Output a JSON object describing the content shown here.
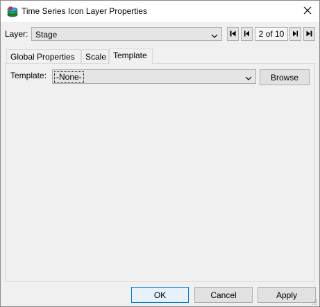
{
  "window": {
    "title": "Time Series Icon Layer Properties"
  },
  "layer": {
    "label": "Layer:",
    "selected": "Stage",
    "page_indicator": "2 of 10"
  },
  "tabs": [
    {
      "label": "Global Properties"
    },
    {
      "label": "Scale"
    },
    {
      "label": "Template"
    }
  ],
  "template": {
    "label": "Template:",
    "selected": "-None-",
    "browse_label": "Browse"
  },
  "footer": {
    "ok_label": "OK",
    "cancel_label": "Cancel",
    "apply_label": "Apply"
  },
  "colors": {
    "default_button_border": "#0078d7",
    "default_button_bg": "#e5f1fb"
  }
}
